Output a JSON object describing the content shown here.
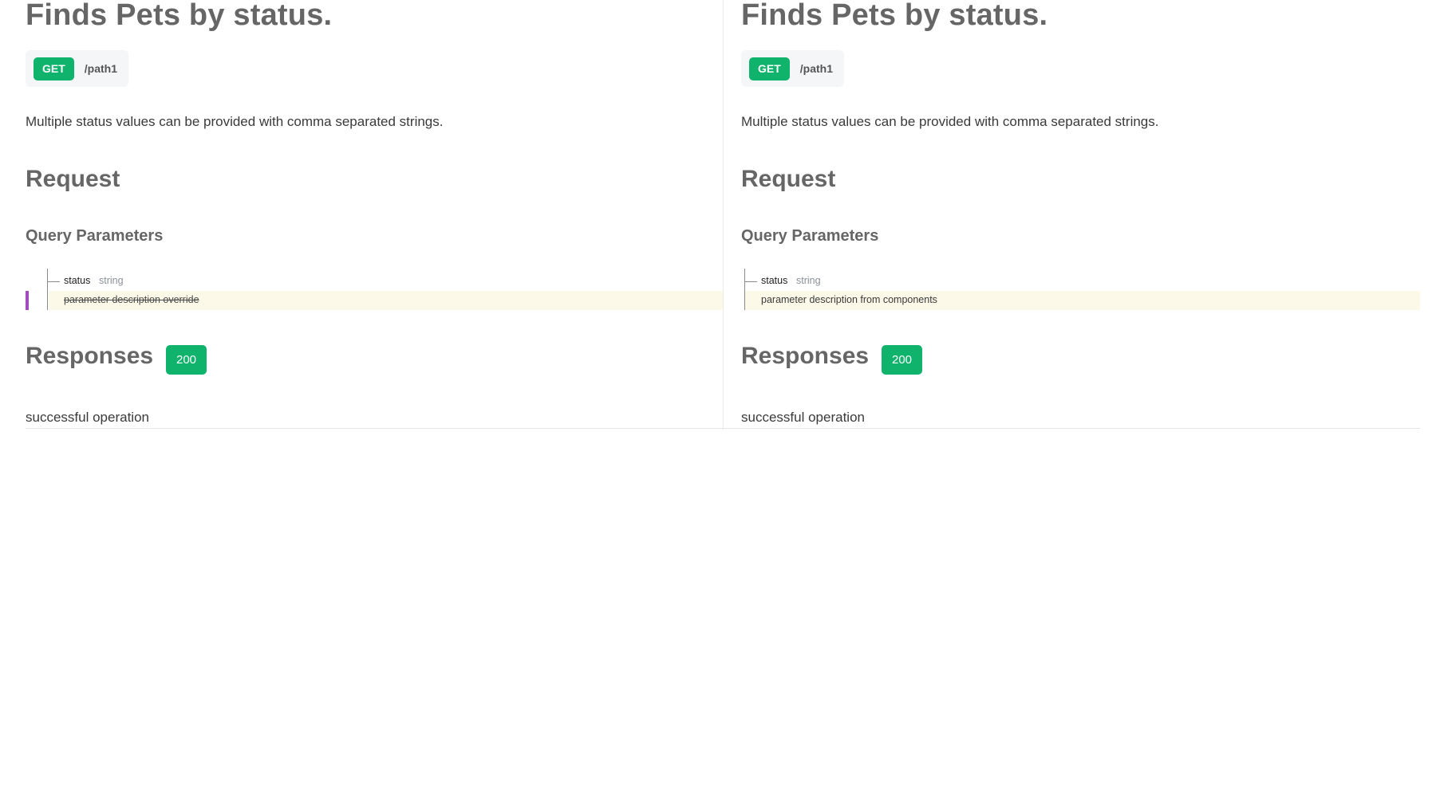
{
  "operation": {
    "title": "Finds Pets by status.",
    "method": "GET",
    "path": "/path1",
    "description": "Multiple status values can be provided with comma separated strings."
  },
  "request": {
    "heading": "Request",
    "query_heading": "Query Parameters",
    "param": {
      "name": "status",
      "type": "string"
    }
  },
  "left": {
    "param_description": "parameter description override"
  },
  "right": {
    "param_description": "parameter description from components"
  },
  "responses": {
    "heading": "Responses",
    "status_code": "200",
    "description": "successful operation"
  },
  "colors": {
    "method_badge": "#0fb36b",
    "status_badge": "#0fb36b",
    "change_marker": "#a24bbf",
    "changed_row_highlight": "#fdf9e8",
    "heading_text": "#666666"
  }
}
